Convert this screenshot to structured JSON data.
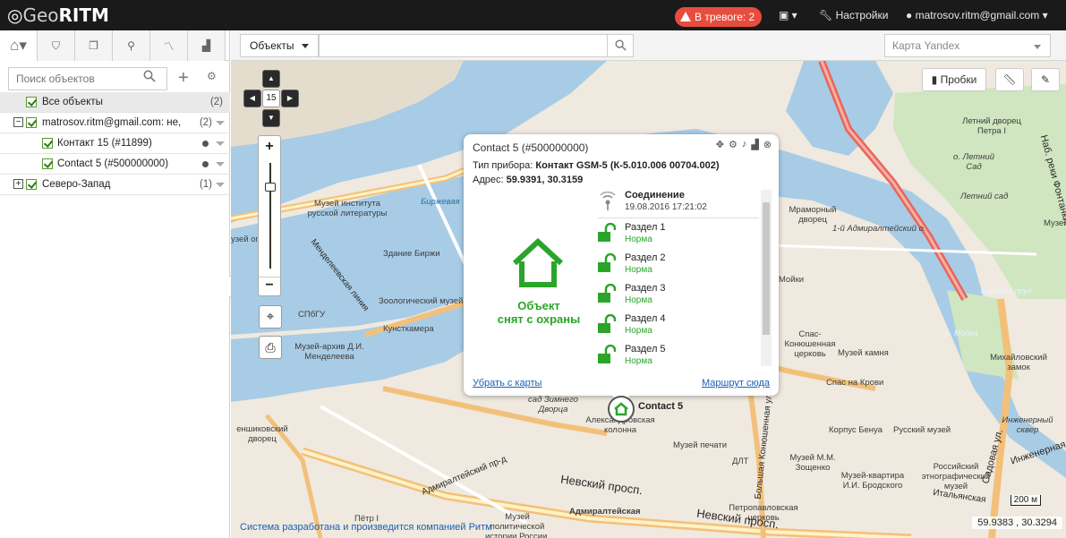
{
  "app": {
    "logo_geo": "Geo",
    "logo_ritm": "RITM"
  },
  "topbar": {
    "alarm_label": "В тревоге: 2",
    "settings_label": "Настройки",
    "user_label": "matrosov.ritm@gmail.com"
  },
  "sidebar": {
    "search_placeholder": "Поиск объектов",
    "tree": [
      {
        "label": "Все объекты",
        "count": "(2)"
      },
      {
        "label": "matrosov.ritm@gmail.com: не,",
        "count": "(2)"
      },
      {
        "label": "Контакт 15 (#11899)"
      },
      {
        "label": "Contact 5 (#500000000)"
      },
      {
        "label": "Северо-Запад",
        "count": "(1)"
      }
    ]
  },
  "map_toolbar": {
    "objects_dropdown": "Объекты",
    "layer_dropdown": "Карта Yandex",
    "traffic_label": "Пробки",
    "zoom_level": "15"
  },
  "popup": {
    "title": "Contact 5 (#500000000)",
    "device_type_label": "Тип прибора:",
    "device_type_value": "Контакт GSM-5 (К-5.010.006 00704.002)",
    "address_label": "Адрес:",
    "address_value": "59.9391, 30.3159",
    "state_line1": "Объект",
    "state_line2": "снят с охраны",
    "connection_label": "Соединение",
    "connection_time": "19.08.2016 17:21:02",
    "sections": [
      {
        "name": "Раздел 1",
        "status": "Норма"
      },
      {
        "name": "Раздел 2",
        "status": "Норма"
      },
      {
        "name": "Раздел 3",
        "status": "Норма"
      },
      {
        "name": "Раздел 4",
        "status": "Норма"
      },
      {
        "name": "Раздел 5",
        "status": "Норма"
      }
    ],
    "remove_link": "Убрать с карты",
    "route_link": "Маршрут сюда"
  },
  "marker_label": "Contact 5",
  "map_labels": {
    "museum_inst": "Музей института русской литературы",
    "birzhevaya": "Биржевая",
    "zdanie_birzhi": "Здание Биржи",
    "zoo_museum": "Зоологический музей",
    "spbgu": "СПбГУ",
    "kunstkamera": "Кунсткамера",
    "mendeleev": "Музей-архив Д.И. Менделеева",
    "mendeleevskaya": "Менделеевская линия",
    "marble": "Мраморный дворец",
    "admiralteysky_o": "1-й Адмиралтейский о.",
    "summer_palace": "Летний дворец Петра I",
    "letny_sad_o": "о. Летний Сад",
    "letny_sad": "Летний сад",
    "fontanka": "Наб. реки Фонтанки",
    "karpiev": "Карпиев пруд",
    "moika": "р. Мойка",
    "spas_konyushennaya": "Спас-Конюшенная церковь",
    "kamnya": "Музей камня",
    "spas_krovi": "Спас на Крови",
    "mikhail": "Михайловский замок",
    "inzhener_sq": "Инженерный сквер",
    "zimnego": "сад Зимнего Дворца",
    "aleks_col": "Александровская колонна",
    "pechati": "Музей печати",
    "dlt": "ДЛТ",
    "benua": "Корпус Бенуа",
    "russian_museum": "Русский музей",
    "zoshchenko": "Музей М.М. Зощенко",
    "brodsky": "Музей-квартира И.И. Бродского",
    "ethno": "Российский этнографический музей",
    "petropavl": "Петропавловская церковь",
    "political": "Музей политической истории России, филиал",
    "admiralteyskaya": "Адмиралтейская",
    "nevsky": "Невский просп.",
    "nevsky2": "Невский просп.",
    "admir_pr": "Адмиралтейский пр-д",
    "konyushennaya": "Большая Конюшенная ул.",
    "sadovaya": "Садовая ул.",
    "inzhenernaya": "Инженерная",
    "italyanskaya": "Итальянская",
    "petr": "Пётр I",
    "shikovsky": "еншиковский дворец",
    "moyka_bank": "Мойки",
    "musey_right": "Музей",
    "muzey_left": "узей оп"
  },
  "scale_label": "200 м",
  "coords": "59.9383 , 30.3294",
  "credit": "Система разработана и произведится компанией Ритм",
  "colors": {
    "alarm": "#e84c3d",
    "ok_green": "#2aa52a",
    "link": "#1a5fb4",
    "water": "#a8cce6"
  }
}
